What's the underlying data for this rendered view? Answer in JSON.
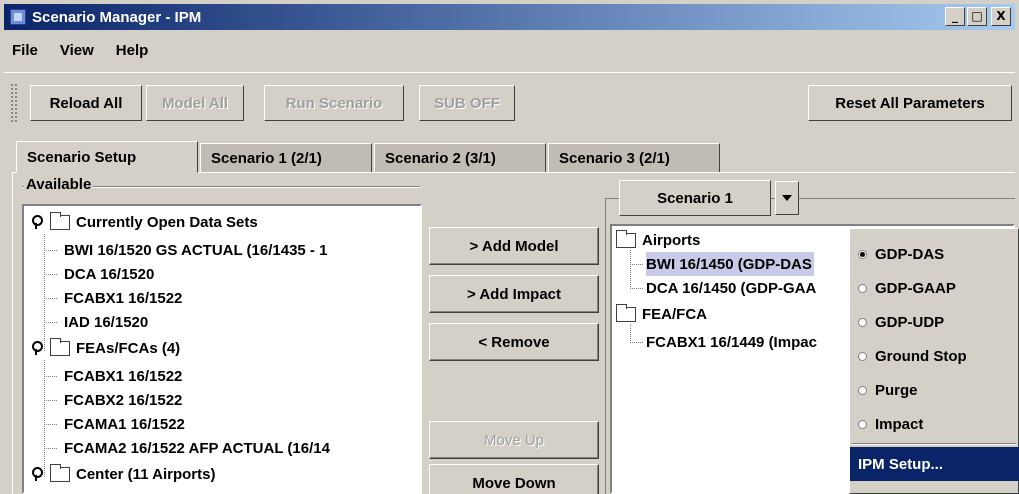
{
  "window": {
    "title": "Scenario Manager - IPM",
    "icon": "scenario-manager-app-icon"
  },
  "window_controls": {
    "minimize": "_",
    "maximize": "□",
    "close": "X"
  },
  "menu": [
    "File",
    "View",
    "Help"
  ],
  "toolbar": {
    "reload_all": "Reload All",
    "model_all": "Model All",
    "run_scenario": "Run Scenario",
    "sub_off": "SUB OFF",
    "reset_all_parameters": "Reset All Parameters"
  },
  "tabs": [
    "Scenario Setup",
    "Scenario 1 (2/1)",
    "Scenario 2 (3/1)",
    "Scenario 3 (2/1)"
  ],
  "available": {
    "label": "Available",
    "groups": [
      {
        "label": "Currently Open Data Sets",
        "items": [
          "BWI 16/1520 GS ACTUAL (16/1435 - 1",
          "DCA 16/1520",
          "FCABX1 16/1522",
          "IAD 16/1520"
        ]
      },
      {
        "label": "FEAs/FCAs (4)",
        "items": [
          "FCABX1 16/1522",
          "FCABX2 16/1522",
          "FCAMA1 16/1522",
          "FCAMA2 16/1522 AFP ACTUAL (16/14"
        ]
      },
      {
        "label": "Center (11 Airports)",
        "items": []
      }
    ]
  },
  "middle_buttons": {
    "add_model": "> Add Model",
    "add_impact": "> Add Impact",
    "remove": "< Remove",
    "move_up": "Move Up",
    "move_down": "Move Down"
  },
  "scenario_select": {
    "selected": "Scenario 1"
  },
  "scenario_tree": {
    "groups": [
      {
        "label": "Airports",
        "items": [
          "BWI 16/1450 (GDP-DAS",
          "DCA 16/1450 (GDP-GAA"
        ]
      },
      {
        "label": "FEA/FCA",
        "items": [
          "FCABX1 16/1449 (Impac"
        ]
      }
    ]
  },
  "context_menu": {
    "options": [
      "GDP-DAS",
      "GDP-GAAP",
      "GDP-UDP",
      "Ground Stop",
      "Purge",
      "Impact"
    ],
    "selected": "GDP-DAS",
    "setup": "IPM Setup..."
  }
}
